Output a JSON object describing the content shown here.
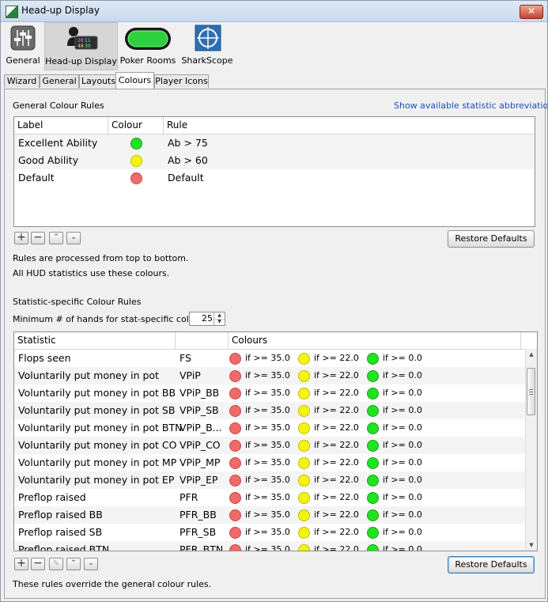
{
  "window": {
    "title": "Head-up Display",
    "close_label": "✕"
  },
  "toolbar": {
    "items": [
      {
        "label": "General",
        "icon": "sliders-icon",
        "selected": false
      },
      {
        "label": "Head-up Display",
        "icon": "hud-player-icon",
        "selected": true
      },
      {
        "label": "Poker Rooms",
        "icon": "poker-table-icon",
        "selected": false
      },
      {
        "label": "SharkScope",
        "icon": "sharkscope-crosshair-icon",
        "selected": false
      }
    ]
  },
  "tabs": [
    {
      "label": "Wizard",
      "active": false
    },
    {
      "label": "General",
      "active": false
    },
    {
      "label": "Layouts",
      "active": false
    },
    {
      "label": "Colours",
      "active": true
    },
    {
      "label": "Player Icons",
      "active": false
    }
  ],
  "general_rules": {
    "heading": "General Colour Rules",
    "link": "Show available statistic abbreviations",
    "columns": [
      "Label",
      "Colour",
      "Rule"
    ],
    "rows": [
      {
        "label": "Excellent Ability",
        "colour": "green",
        "rule": "Ab > 75"
      },
      {
        "label": "Good Ability",
        "colour": "yellow",
        "rule": "Ab > 60"
      },
      {
        "label": "Default",
        "colour": "red",
        "rule": "Default"
      }
    ],
    "restore_label": "Restore Defaults",
    "note1": "Rules are processed from top to bottom.",
    "note2": "All HUD statistics use these colours."
  },
  "stat_rules": {
    "heading": "Statistic-specific Colour Rules",
    "min_hands_label": "Minimum # of hands for stat-specific colours:",
    "min_hands_value": "25",
    "columns": [
      "Statistic",
      "",
      "Colours"
    ],
    "conditions": [
      "if >= 35.0",
      "if >= 22.0",
      "if >= 0.0"
    ],
    "rows": [
      {
        "name": "Flops seen",
        "abbr": "FS"
      },
      {
        "name": "Voluntarily put money in pot",
        "abbr": "VPiP"
      },
      {
        "name": "Voluntarily put money in pot BB",
        "abbr": "VPiP_BB"
      },
      {
        "name": "Voluntarily put money in pot SB",
        "abbr": "VPiP_SB"
      },
      {
        "name": "Voluntarily put money in pot BTN",
        "abbr": "VPiP_B..."
      },
      {
        "name": "Voluntarily put money in pot CO",
        "abbr": "VPiP_CO"
      },
      {
        "name": "Voluntarily put money in pot MP",
        "abbr": "VPiP_MP"
      },
      {
        "name": "Voluntarily put money in pot EP",
        "abbr": "VPiP_EP"
      },
      {
        "name": "Preflop raised",
        "abbr": "PFR"
      },
      {
        "name": "Preflop raised BB",
        "abbr": "PFR_BB"
      },
      {
        "name": "Preflop raised SB",
        "abbr": "PFR_SB"
      },
      {
        "name": "Preflop raised BTN",
        "abbr": "PFR_BTN"
      }
    ],
    "restore_label": "Restore Defaults",
    "note": "These rules override the general colour rules."
  },
  "colors": {
    "green": "#21e321",
    "yellow": "#f5f50c",
    "red": "#f06a6a",
    "link": "#1a4fbf"
  }
}
